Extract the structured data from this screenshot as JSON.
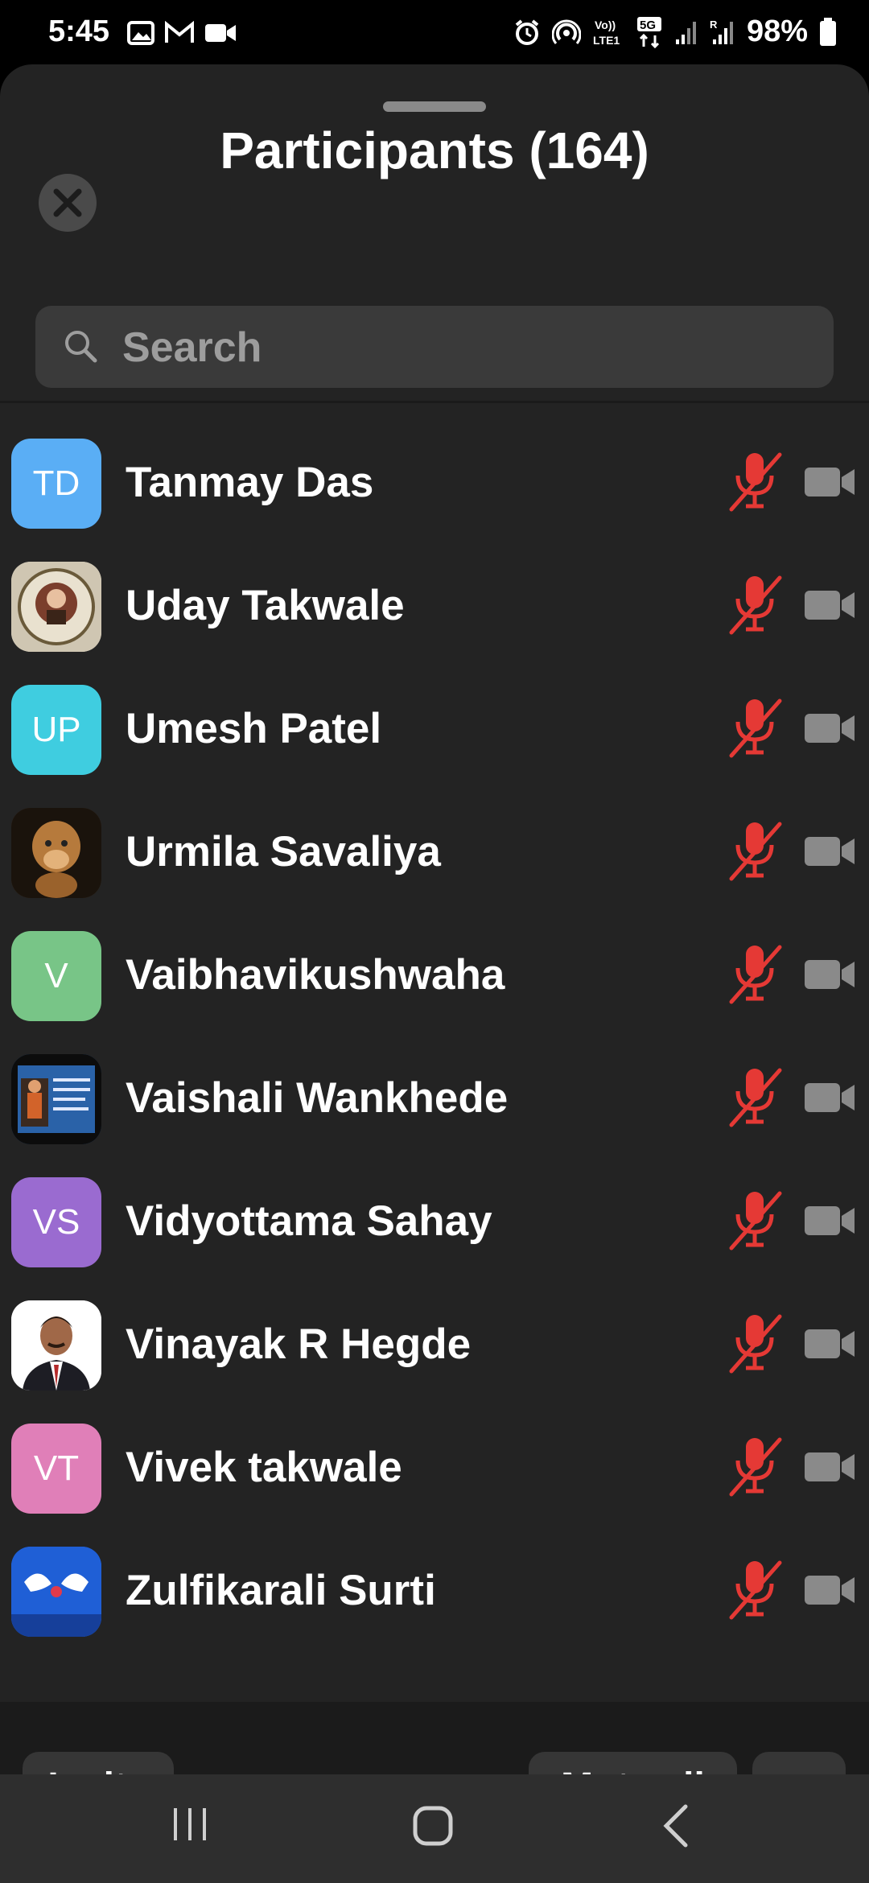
{
  "status_bar": {
    "time": "5:45",
    "battery": "98%",
    "left_icons": [
      "gallery-icon",
      "gmail-icon",
      "video-icon"
    ],
    "right_icons": [
      "alarm-icon",
      "hotspot-icon",
      "volte-icon",
      "5g-icon",
      "signal-icon",
      "signal-roaming-icon",
      "battery-icon"
    ]
  },
  "sheet": {
    "title": "Participants (164)",
    "search_placeholder": "Search"
  },
  "colors": {
    "sheet_bg": "#232323",
    "muted_mic": "#e53935",
    "camera_off": "#8a8a8a"
  },
  "participants": [
    {
      "name": "Tanmay Das",
      "initials": "TD",
      "avatar_color": "#5aaef5",
      "avatar_type": "initials",
      "mic": "muted",
      "video": "off"
    },
    {
      "name": "Uday Takwale",
      "initials": "",
      "avatar_color": "#d8cfbd",
      "avatar_type": "photo",
      "mic": "muted",
      "video": "off"
    },
    {
      "name": "Umesh Patel",
      "initials": "UP",
      "avatar_color": "#3fcde0",
      "avatar_type": "initials",
      "mic": "muted",
      "video": "off"
    },
    {
      "name": "Urmila Savaliya",
      "initials": "",
      "avatar_color": "#4a3420",
      "avatar_type": "photo",
      "mic": "muted",
      "video": "off"
    },
    {
      "name": "Vaibhavikushwaha",
      "initials": "V",
      "avatar_color": "#78c587",
      "avatar_type": "initials",
      "mic": "muted",
      "video": "off"
    },
    {
      "name": "Vaishali Wankhede",
      "initials": "",
      "avatar_color": "#1d4e8a",
      "avatar_type": "photo",
      "mic": "muted",
      "video": "off"
    },
    {
      "name": "Vidyottama Sahay",
      "initials": "VS",
      "avatar_color": "#9a6bd0",
      "avatar_type": "initials",
      "mic": "muted",
      "video": "off"
    },
    {
      "name": "Vinayak R Hegde",
      "initials": "",
      "avatar_color": "#f2f2f2",
      "avatar_type": "photo",
      "mic": "muted",
      "video": "off"
    },
    {
      "name": "Vivek takwale",
      "initials": "VT",
      "avatar_color": "#e07fb8",
      "avatar_type": "initials",
      "mic": "muted",
      "video": "off"
    },
    {
      "name": "Zulfikarali Surti",
      "initials": "",
      "avatar_color": "#1f5fd6",
      "avatar_type": "photo",
      "mic": "muted",
      "video": "off"
    }
  ],
  "footer": {
    "invite_label": "Invite",
    "mute_all_label": "Mute all",
    "more_label": "•••"
  },
  "nav_bar": [
    "recents-icon",
    "home-icon",
    "back-icon"
  ]
}
